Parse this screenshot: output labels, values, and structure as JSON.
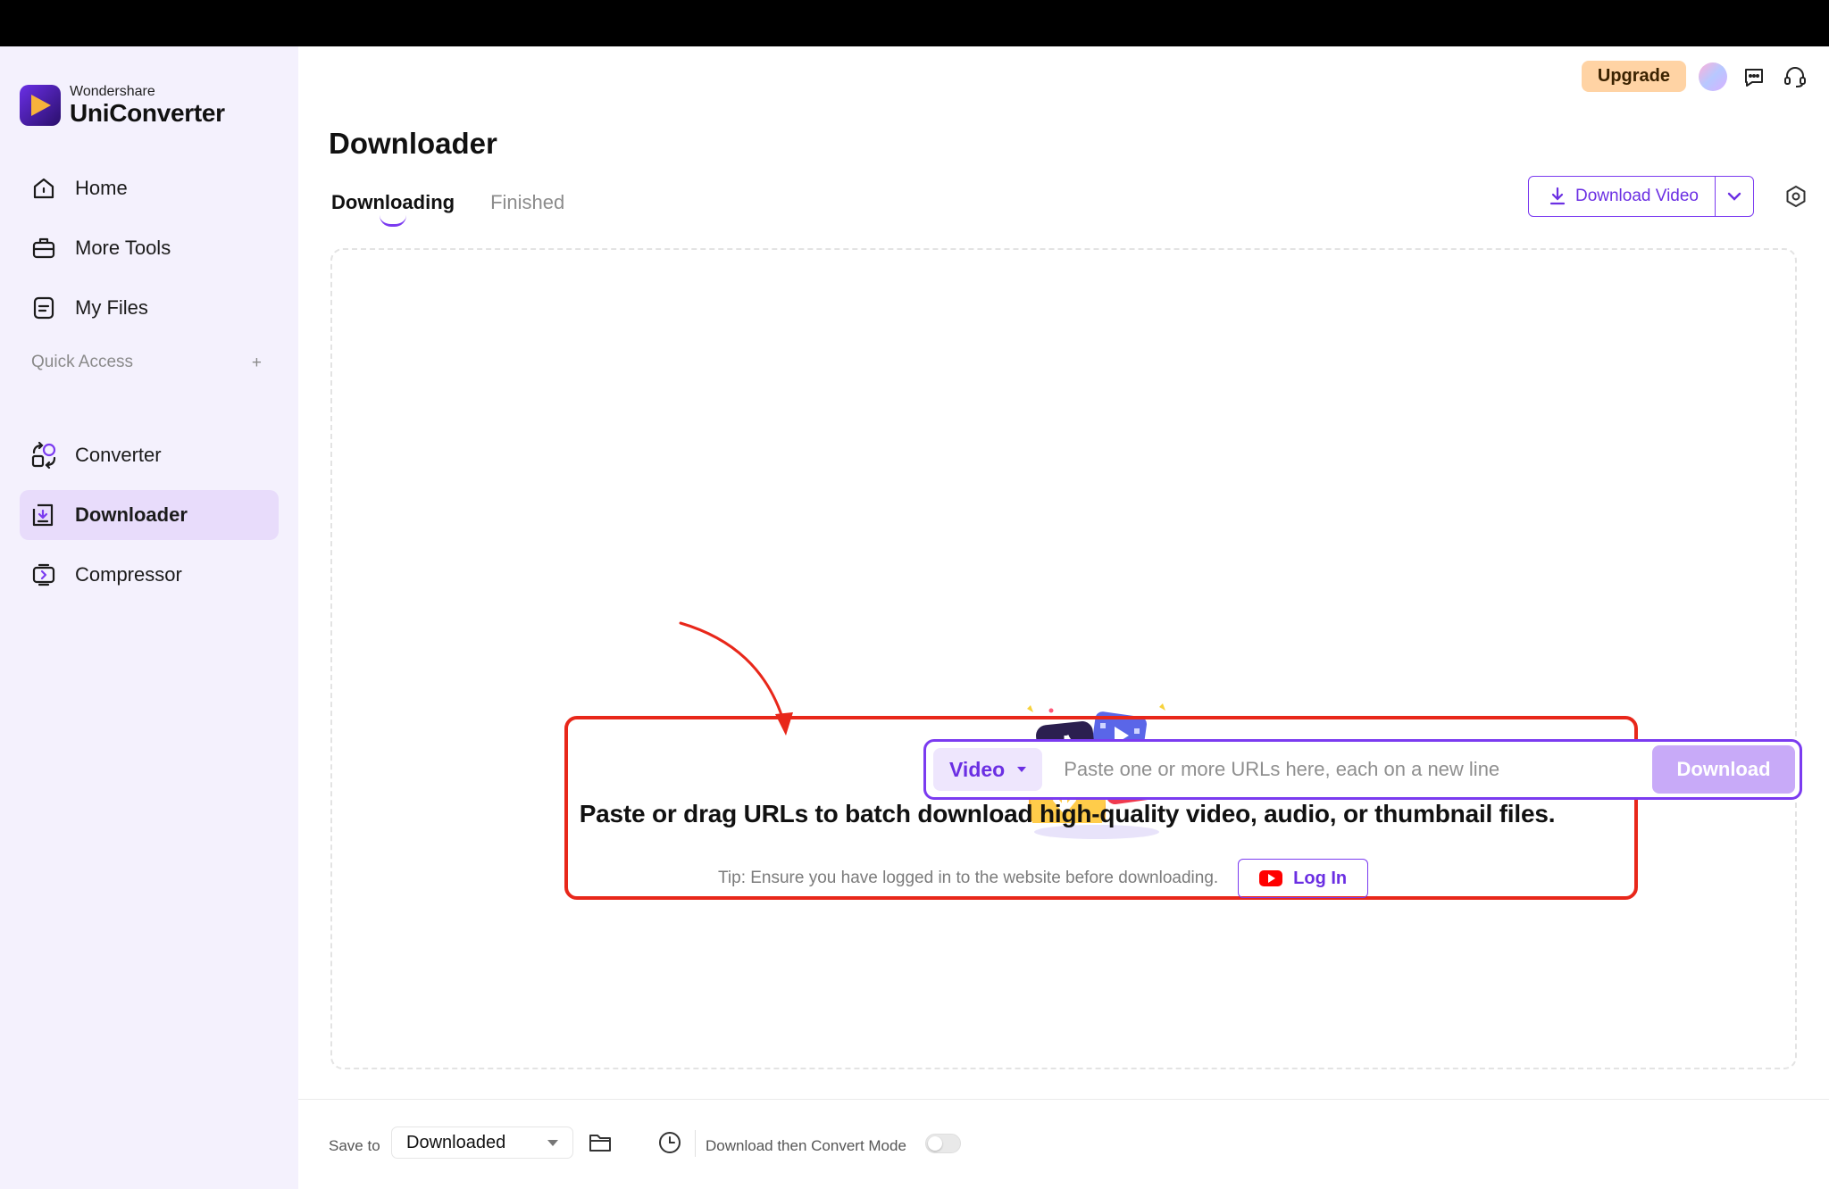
{
  "brand": {
    "company": "Wondershare",
    "product": "UniConverter"
  },
  "sidebar": {
    "items": [
      {
        "label": "Home",
        "icon": "home-icon"
      },
      {
        "label": "More Tools",
        "icon": "toolbox-icon"
      },
      {
        "label": "My Files",
        "icon": "file-icon"
      }
    ],
    "quick_access_label": "Quick Access",
    "quick_items": [
      {
        "label": "Converter",
        "icon": "converter-icon"
      },
      {
        "label": "Downloader",
        "icon": "downloader-icon",
        "active": true
      },
      {
        "label": "Compressor",
        "icon": "compressor-icon"
      }
    ]
  },
  "header": {
    "upgrade_label": "Upgrade"
  },
  "page": {
    "title": "Downloader",
    "tabs": [
      {
        "label": "Downloading",
        "active": true
      },
      {
        "label": "Finished",
        "active": false
      }
    ],
    "download_video_label": "Download Video"
  },
  "url_bar": {
    "type_label": "Video",
    "placeholder": "Paste one or more URLs here, each on a new line",
    "download_label": "Download"
  },
  "headline": "Paste or drag URLs to batch download high-quality video, audio, or thumbnail files.",
  "tip": {
    "text": "Tip: Ensure you have logged in to the website before downloading.",
    "login_label": "Log In"
  },
  "bottom": {
    "save_to_label": "Save to",
    "save_to_value": "Downloaded",
    "mode_label": "Download then Convert Mode",
    "mode_enabled": false
  },
  "colors": {
    "accent": "#7b3bf0",
    "sidebar_bg": "#f4f1fd",
    "active_item_bg": "#e8dcfb",
    "highlight_red": "#e8271a",
    "upgrade_bg": "#ffd3a4"
  }
}
